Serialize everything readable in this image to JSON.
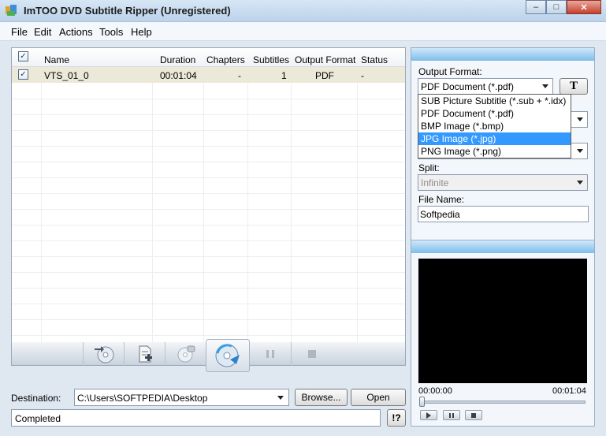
{
  "window": {
    "title": "ImTOO DVD Subtitle Ripper (Unregistered)",
    "minimize": "–",
    "maximize": "□",
    "close": "✕"
  },
  "menu": [
    "File",
    "Edit",
    "Actions",
    "Tools",
    "Help"
  ],
  "list": {
    "columns": [
      "Name",
      "Duration",
      "Chapters",
      "Subtitles",
      "Output Format",
      "Status"
    ],
    "rows": [
      {
        "checked": true,
        "name": "VTS_01_0",
        "duration": "00:01:04",
        "chapters": "-",
        "subtitles": "1",
        "output_format": "PDF",
        "status": "-"
      }
    ]
  },
  "toolbar": {
    "icons": [
      "add-dvd-icon",
      "add-file-icon",
      "remove-icon",
      "rip-icon",
      "pause-icon",
      "stop-icon"
    ]
  },
  "destination": {
    "label": "Destination:",
    "path": "C:\\Users\\SOFTPEDIA\\Desktop",
    "browse": "Browse...",
    "open": "Open"
  },
  "status": {
    "text": "Completed",
    "help": "!?"
  },
  "settings": {
    "output_format_label": "Output Format:",
    "output_format_value": "PDF Document (*.pdf)",
    "font_button": "T",
    "dropdown_options": [
      "SUB Picture Subtitle (*.sub + *.idx)",
      "PDF Document (*.pdf)",
      "BMP Image (*.bmp)",
      "JPG Image (*.jpg)",
      "PNG Image (*.png)"
    ],
    "dropdown_selected_index": 3,
    "split_label": "Split:",
    "split_value": "Infinite",
    "file_name_label": "File Name:",
    "file_name_value": "Softpedia"
  },
  "player": {
    "time_start": "00:00:00",
    "time_end": "00:01:04",
    "position": 0
  },
  "colors": {
    "selected_row": "#ece9d8",
    "dropdown_highlight": "#3399ff",
    "panel_header": "#7fbde9"
  }
}
